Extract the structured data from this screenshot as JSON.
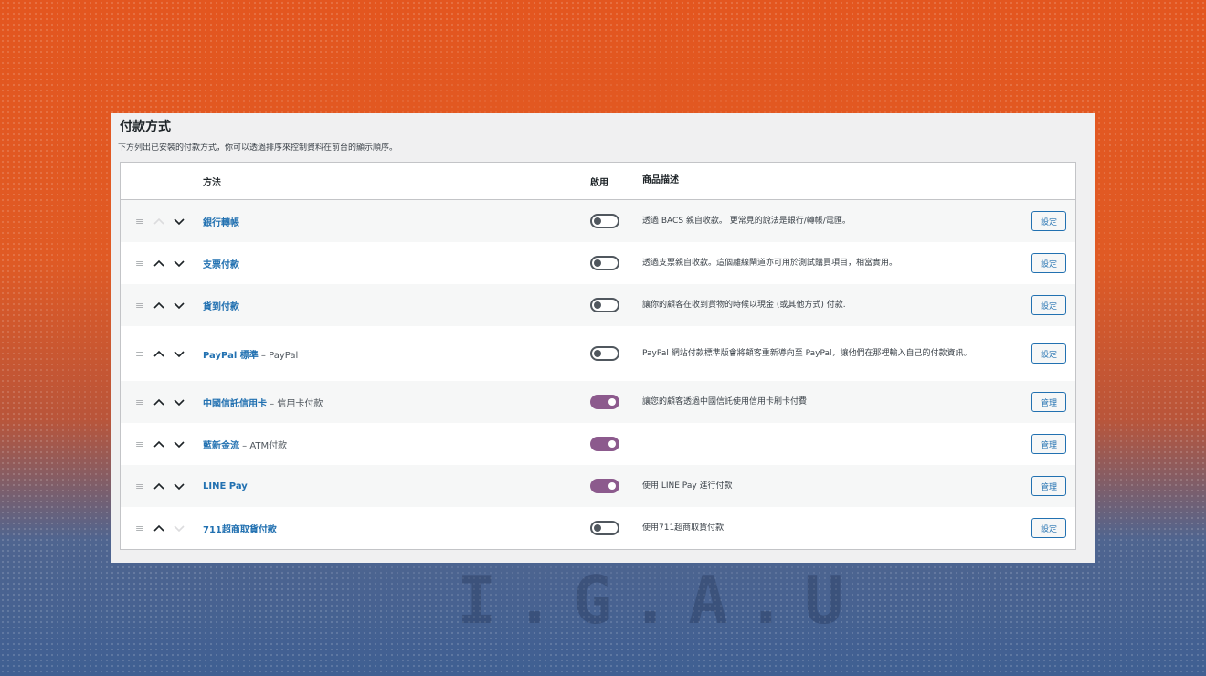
{
  "section": {
    "title": "付款方式",
    "description": "下方列出已安裝的付款方式，你可以透過排序來控制資料在前台的顯示順序。"
  },
  "table": {
    "headers": {
      "method": "方法",
      "enabled": "啟用",
      "description": "商品描述"
    },
    "rows": [
      {
        "name": "銀行轉帳",
        "subtitle": "",
        "enabled": false,
        "description": "透過 BACS 親自收款。 更常見的說法是銀行/轉帳/電匯。",
        "action": "設定",
        "up_disabled": true,
        "down_disabled": false
      },
      {
        "name": "支票付款",
        "subtitle": "",
        "enabled": false,
        "description": "透過支票親自收款。這個離線閘道亦可用於測試購買項目，相當實用。",
        "action": "設定",
        "up_disabled": false,
        "down_disabled": false
      },
      {
        "name": "貨到付款",
        "subtitle": "",
        "enabled": false,
        "description": "讓你的顧客在收到貨物的時候以現金 (或其他方式) 付款.",
        "action": "設定",
        "up_disabled": false,
        "down_disabled": false
      },
      {
        "name": "PayPal 標準",
        "subtitle": " – PayPal",
        "enabled": false,
        "description": "PayPal 網站付款標準版會將顧客重新導向至 PayPal，讓他們在那裡輸入自己的付款資訊。",
        "action": "設定",
        "up_disabled": false,
        "down_disabled": false
      },
      {
        "name": "中國信託信用卡",
        "subtitle": " – 信用卡付款",
        "enabled": true,
        "description": "讓您的顧客透過中國信託使用信用卡刷卡付費",
        "action": "管理",
        "up_disabled": false,
        "down_disabled": false
      },
      {
        "name": "藍新金流",
        "subtitle": " – ATM付款",
        "enabled": true,
        "description": "",
        "action": "管理",
        "up_disabled": false,
        "down_disabled": false
      },
      {
        "name": "LINE Pay",
        "subtitle": "",
        "enabled": true,
        "description": "使用 LINE Pay 進行付款",
        "action": "管理",
        "up_disabled": false,
        "down_disabled": false
      },
      {
        "name": "711超商取貨付款",
        "subtitle": "",
        "enabled": false,
        "description": "使用711超商取貨付款",
        "action": "設定",
        "up_disabled": false,
        "down_disabled": true
      }
    ]
  },
  "colors": {
    "link": "#2271b1",
    "toggle_on": "#8c5a8d",
    "toggle_off": "#50575e"
  },
  "icons": {
    "drag": "drag-handle-icon",
    "up": "chevron-up-icon",
    "down": "chevron-down-icon"
  }
}
